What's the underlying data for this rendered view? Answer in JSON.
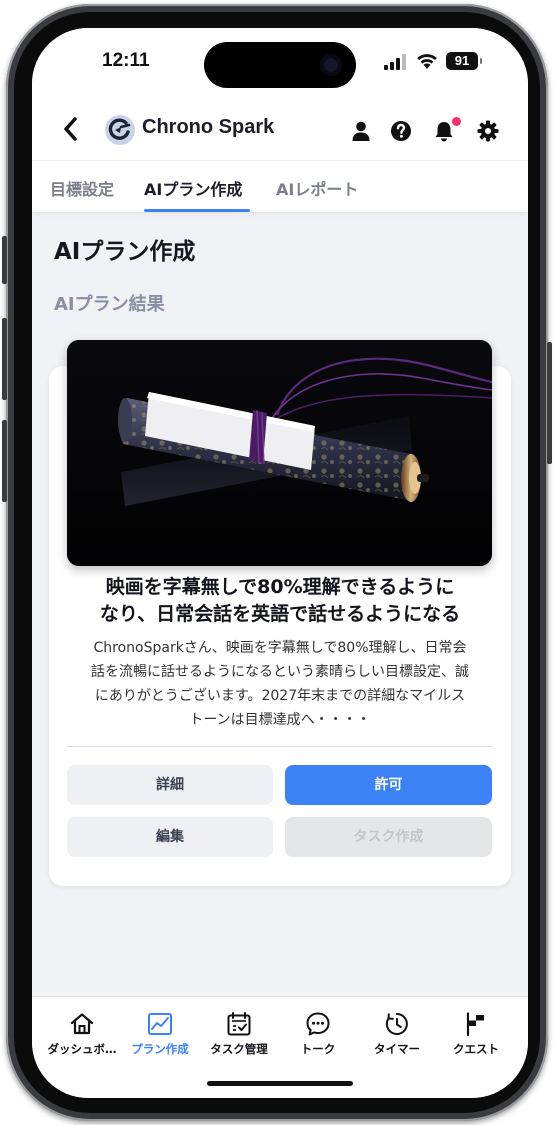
{
  "status_bar": {
    "time": "12:11",
    "battery": "91"
  },
  "header": {
    "app_title": "Chrono Spark",
    "notification_dot_color": "#ff2d6e"
  },
  "tabs": [
    {
      "label": "目標設定",
      "active": false
    },
    {
      "label": "AIプラン作成",
      "active": true
    },
    {
      "label": "AIレポート",
      "active": false
    }
  ],
  "page": {
    "title": "AIプラン作成",
    "section_title": "AIプラン結果"
  },
  "plan_card": {
    "image_alt": "scroll-image",
    "goal_title_line1": "映画を字幕無しで80%理解できるように",
    "goal_title_line2": "なり、日常会話を英語で話せるようになる",
    "body_line1": "ChronoSparkさん、映画を字幕無しで80%理解し、日常会",
    "body_line2": "話を流暢に話せるようになるという素晴らしい目標設定、誠",
    "body_line3": "にありがとうございます。2027年末までの詳細なマイルス",
    "body_line4": "トーンは目標達成へ・・・・",
    "buttons": {
      "details": "詳細",
      "approve": "許可",
      "edit": "編集",
      "create_task": "タスク作成"
    }
  },
  "bottom_nav": [
    {
      "label": "ダッシュボ…",
      "icon": "home-icon",
      "active": false
    },
    {
      "label": "プラン作成",
      "icon": "chart-icon",
      "active": true
    },
    {
      "label": "タスク管理",
      "icon": "calendar-check-icon",
      "active": false
    },
    {
      "label": "トーク",
      "icon": "chat-icon",
      "active": false
    },
    {
      "label": "タイマー",
      "icon": "timer-icon",
      "active": false
    },
    {
      "label": "クエスト",
      "icon": "flag-icon",
      "active": false
    }
  ],
  "colors": {
    "accent": "#3b82f6",
    "background": "#f1f2f6"
  }
}
